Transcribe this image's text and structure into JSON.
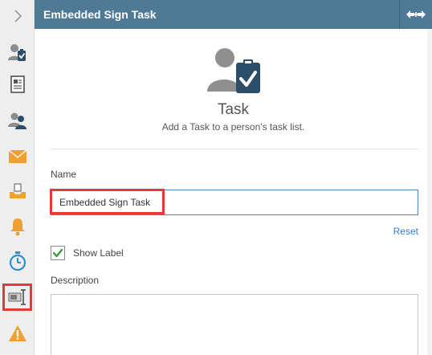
{
  "header": {
    "title": "Embedded Sign Task"
  },
  "hero": {
    "title": "Task",
    "description": "Add a Task to a person's task list."
  },
  "form": {
    "name_label": "Name",
    "name_value": "Embedded Sign Task",
    "reset_label": "Reset",
    "show_label_text": "Show Label",
    "show_label_checked": true,
    "description_label": "Description",
    "description_value": ""
  },
  "sidebar": {
    "items": [
      {
        "icon": "chevron-right-icon"
      },
      {
        "icon": "task-person-icon"
      },
      {
        "icon": "document-icon"
      },
      {
        "icon": "people-icon"
      },
      {
        "icon": "mail-icon"
      },
      {
        "icon": "inbox-tray-icon"
      },
      {
        "icon": "bell-icon"
      },
      {
        "icon": "timer-icon"
      },
      {
        "icon": "embedded-sign-icon",
        "selected": true
      },
      {
        "icon": "warning-icon"
      }
    ]
  },
  "colors": {
    "header_bg": "#4e7a96",
    "accent_blue": "#4a86c5",
    "highlight_red": "#e53935",
    "icon_blue": "#2a8fd0",
    "icon_orange": "#f0a030"
  }
}
